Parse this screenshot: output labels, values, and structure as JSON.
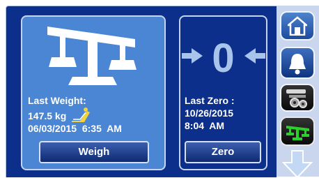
{
  "weigh_panel": {
    "last_weight_label": "Last Weight:",
    "weight_value": "147.5 kg",
    "date_time": "06/03/2015  6:35  AM",
    "button_label": "Weigh",
    "scale_icon": "scale-icon",
    "patient_icon": "reclining-patient-icon"
  },
  "zero_panel": {
    "zero_value": "0",
    "last_zero_label": "Last Zero :",
    "date": "10/26/2015",
    "time": "8:04  AM",
    "button_label": "Zero",
    "left_arrow_icon": "arrow-right-icon",
    "right_arrow_icon": "arrow-left-icon"
  },
  "sidebar": {
    "items": [
      {
        "icon": "home-icon"
      },
      {
        "icon": "bell-icon"
      },
      {
        "icon": "tools-icon"
      },
      {
        "icon": "scale-icon"
      },
      {
        "icon": "arrow-down-icon"
      }
    ]
  },
  "colors": {
    "background": "#0b2f8a",
    "weigh_panel": "#4a86d4",
    "active_green": "#2bd12b",
    "sidebar": "#c9d6ee"
  }
}
